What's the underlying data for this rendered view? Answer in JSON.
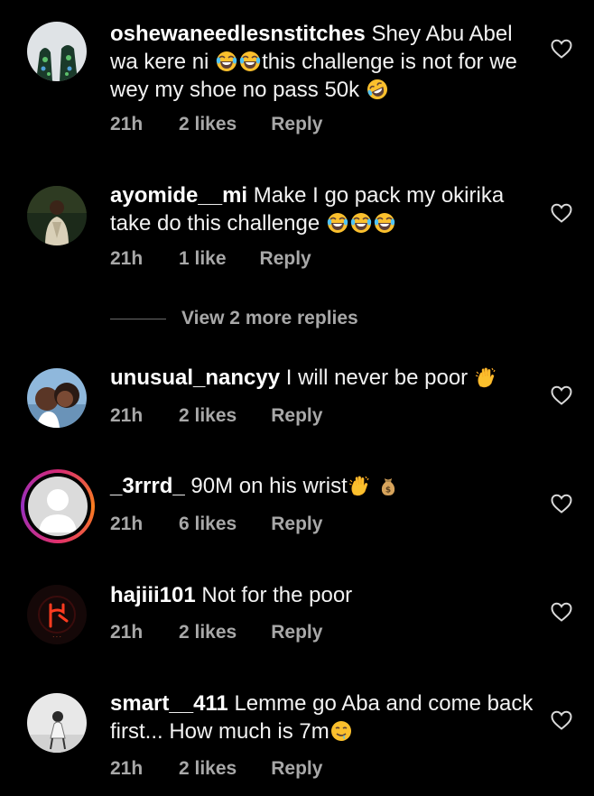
{
  "colors": {
    "background": "#000000",
    "text": "#f2f2f2",
    "meta": "#a8a8a8",
    "story_ring": [
      "#d62976",
      "#fa7e1e",
      "#962fbf"
    ]
  },
  "comments": [
    {
      "username": "oshewaneedlesnstitches",
      "text_parts": [
        "Shey Abu Abel wa kere ni ",
        "this challenge is not for we wey my shoe no pass 50k "
      ],
      "emojis": [
        "laughing-tears",
        "laughing-tears",
        "rofl"
      ],
      "time": "21h",
      "likes": "2 likes",
      "reply": "Reply"
    },
    {
      "username": "ayomide__mi",
      "text_parts": [
        "Make I go pack my okirika take do this challenge "
      ],
      "emojis": [
        "laughing-tears",
        "laughing-tears",
        "laughing-tears"
      ],
      "time": "21h",
      "likes": "1 like",
      "reply": "Reply"
    },
    {
      "username": "unusual_nancyy",
      "text_parts": [
        "I will never be poor "
      ],
      "emojis": [
        "waving-hand"
      ],
      "time": "21h",
      "likes": "2 likes",
      "reply": "Reply"
    },
    {
      "username": "_3rrrd_",
      "text_parts": [
        "90M on his wrist"
      ],
      "emojis": [
        "waving-hand",
        "money-bag"
      ],
      "time": "21h",
      "likes": "6 likes",
      "reply": "Reply"
    },
    {
      "username": "hajiii101",
      "text_parts": [
        "Not for the poor"
      ],
      "emojis": [],
      "time": "21h",
      "likes": "2 likes",
      "reply": "Reply"
    },
    {
      "username": "smart__411",
      "text_parts": [
        "Lemme go Aba and come back first... How much is 7m"
      ],
      "emojis": [
        "drooling-face"
      ],
      "time": "21h",
      "likes": "2 likes",
      "reply": "Reply"
    }
  ],
  "view_more_replies": "View 2 more replies"
}
